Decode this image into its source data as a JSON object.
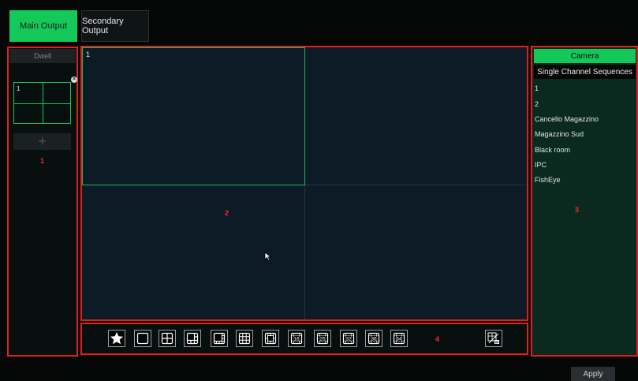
{
  "tabs": {
    "main_label": "Main Output",
    "secondary_label": "Secondary Output"
  },
  "left_panel": {
    "dwell_label": "Dwell",
    "mini_layout_number": "1",
    "add_label": "+",
    "region_label": "1"
  },
  "center": {
    "cell_number": "1",
    "region_label": "2"
  },
  "right_panel": {
    "camera_tab": "Camera",
    "sequence_tab": "Single Channel Sequences",
    "cameras": [
      "1",
      "2",
      "Cancello Magazzino",
      "Magazzino Sud",
      "Black room",
      "IPC",
      "FishEye"
    ],
    "region_label": "3"
  },
  "toolbar": {
    "region_label": "4",
    "buttons": [
      {
        "icon": "star-icon"
      },
      {
        "icon": "layout-1-icon"
      },
      {
        "icon": "layout-4-icon"
      },
      {
        "icon": "layout-6-icon"
      },
      {
        "icon": "layout-8-icon"
      },
      {
        "icon": "layout-9-icon"
      },
      {
        "icon": "layout-13-icon"
      },
      {
        "icon": "layout-16-icon",
        "label": "16"
      },
      {
        "icon": "layout-25-icon",
        "label": "25"
      },
      {
        "icon": "layout-32-icon",
        "label": "32"
      },
      {
        "icon": "layout-36-icon",
        "label": "36"
      },
      {
        "icon": "layout-64-icon",
        "label": "64"
      },
      {
        "icon": "custom-layout-icon"
      }
    ]
  },
  "apply_label": "Apply",
  "colors": {
    "accent": "#14c95a",
    "region_border": "#e01f1f",
    "video_bg": "#0d1b27",
    "camera_list_bg": "#0a2a20"
  }
}
